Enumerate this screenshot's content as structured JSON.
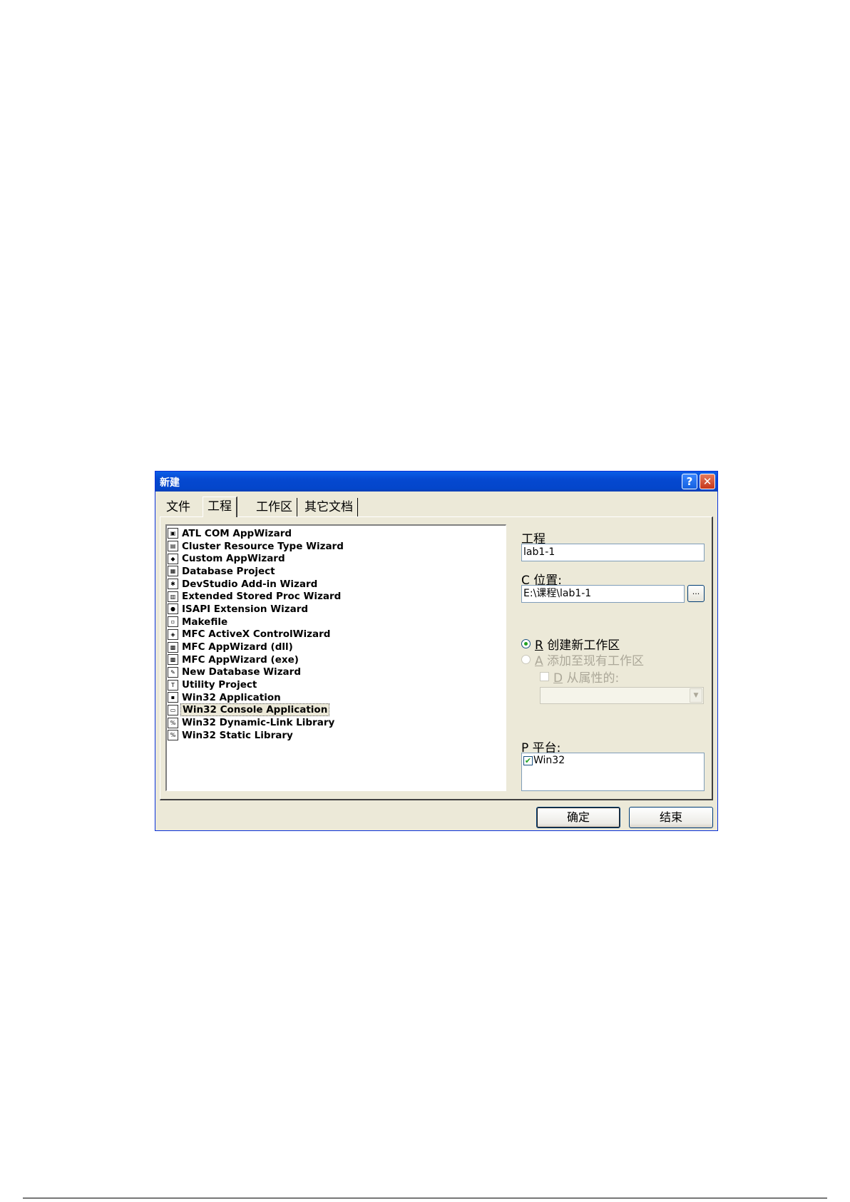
{
  "dialog": {
    "title": "新建",
    "help_glyph": "?",
    "close_glyph": "✕"
  },
  "tabs": [
    {
      "label": "文件"
    },
    {
      "label": "工程"
    },
    {
      "label": "工作区"
    },
    {
      "label": "其它文档"
    }
  ],
  "project_types": [
    {
      "label": "ATL COM AppWizard",
      "icon": "atl-icon"
    },
    {
      "label": "Cluster Resource Type Wizard",
      "icon": "cluster-icon"
    },
    {
      "label": "Custom AppWizard",
      "icon": "custom-wizard-icon"
    },
    {
      "label": "Database Project",
      "icon": "database-icon"
    },
    {
      "label": "DevStudio Add-in Wizard",
      "icon": "addin-icon"
    },
    {
      "label": "Extended Stored Proc Wizard",
      "icon": "stored-proc-icon"
    },
    {
      "label": "ISAPI Extension Wizard",
      "icon": "globe-icon"
    },
    {
      "label": "Makefile",
      "icon": "makefile-icon"
    },
    {
      "label": "MFC ActiveX ControlWizard",
      "icon": "activex-icon"
    },
    {
      "label": "MFC AppWizard (dll)",
      "icon": "mfc-dll-icon"
    },
    {
      "label": "MFC AppWizard (exe)",
      "icon": "mfc-exe-icon"
    },
    {
      "label": "New Database Wizard",
      "icon": "new-db-icon"
    },
    {
      "label": "Utility Project",
      "icon": "utility-icon"
    },
    {
      "label": "Win32 Application",
      "icon": "win32-app-icon"
    },
    {
      "label": "Win32 Console Application",
      "icon": "console-icon",
      "selected": true
    },
    {
      "label": "Win32 Dynamic-Link Library",
      "icon": "dll-icon"
    },
    {
      "label": "Win32 Static Library",
      "icon": "lib-icon"
    }
  ],
  "project_name": {
    "label": "工程",
    "value": "lab1-1"
  },
  "location": {
    "accel": "C",
    "label": " 位置:",
    "value": "E:\\课程\\lab1-1",
    "browse_label": "..."
  },
  "workspace": {
    "create_new": {
      "accel": "R",
      "label": " 创建新工作区",
      "checked": true
    },
    "add_existing": {
      "accel": "A",
      "label": " 添加至现有工作区",
      "checked": false
    },
    "dependency": {
      "accel": "D",
      "label": " 从属性的:",
      "checked": false
    }
  },
  "platform": {
    "accel": "P",
    "label": " 平台:",
    "items": [
      {
        "label": "Win32",
        "checked": true
      }
    ]
  },
  "buttons": {
    "ok": "确定",
    "cancel": "结束"
  },
  "colors": {
    "titlebar": "#0548d0",
    "dialog_bg": "#ece9d8",
    "radio_dot": "#21a121"
  }
}
